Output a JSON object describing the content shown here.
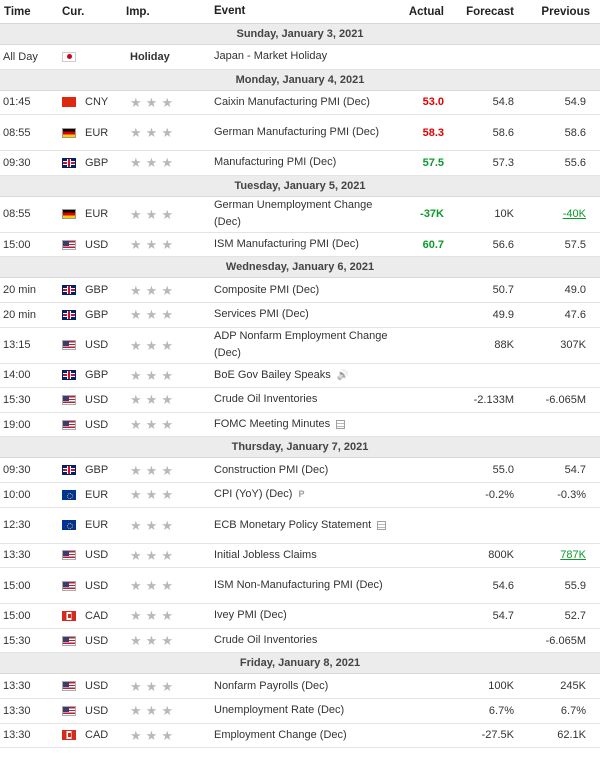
{
  "columns": {
    "time": "Time",
    "currency": "Cur.",
    "importance": "Imp.",
    "event": "Event",
    "actual": "Actual",
    "forecast": "Forecast",
    "previous": "Previous"
  },
  "icons": {
    "star": "star-icon",
    "sound": "speaker-icon",
    "doc": "document-icon",
    "pre": "preliminary-icon"
  },
  "days": [
    {
      "date": "Sunday, January 3, 2021",
      "events": [
        {
          "time": "All Day",
          "flag": "jp",
          "currency": "",
          "holiday": "Holiday",
          "event": "Japan - Market Holiday",
          "actual": "",
          "forecast": "",
          "previous": "",
          "actual_color": "",
          "prev_color": "",
          "tall": false,
          "icon": ""
        }
      ]
    },
    {
      "date": "Monday, January 4, 2021",
      "events": [
        {
          "time": "01:45",
          "flag": "cn",
          "currency": "CNY",
          "event": "Caixin Manufacturing PMI (Dec)",
          "actual": "53.0",
          "forecast": "54.8",
          "previous": "54.9",
          "actual_color": "red",
          "prev_color": "",
          "tall": false,
          "icon": ""
        },
        {
          "time": "08:55",
          "flag": "de",
          "currency": "EUR",
          "event": "German Manufacturing PMI (Dec)",
          "actual": "58.3",
          "forecast": "58.6",
          "previous": "58.6",
          "actual_color": "red",
          "prev_color": "",
          "tall": true,
          "icon": ""
        },
        {
          "time": "09:30",
          "flag": "gb",
          "currency": "GBP",
          "event": "Manufacturing PMI (Dec)",
          "actual": "57.5",
          "forecast": "57.3",
          "previous": "55.6",
          "actual_color": "green",
          "prev_color": "",
          "tall": false,
          "icon": ""
        }
      ]
    },
    {
      "date": "Tuesday, January 5, 2021",
      "events": [
        {
          "time": "08:55",
          "flag": "de",
          "currency": "EUR",
          "event": "German Unemployment Change (Dec)",
          "actual": "-37K",
          "forecast": "10K",
          "previous": "-40K",
          "actual_color": "green",
          "prev_color": "ul-green",
          "tall": true,
          "icon": ""
        },
        {
          "time": "15:00",
          "flag": "us",
          "currency": "USD",
          "event": "ISM Manufacturing PMI (Dec)",
          "actual": "60.7",
          "forecast": "56.6",
          "previous": "57.5",
          "actual_color": "green",
          "prev_color": "",
          "tall": false,
          "icon": ""
        }
      ]
    },
    {
      "date": "Wednesday, January 6, 2021",
      "events": [
        {
          "time": "20 min",
          "flag": "gb",
          "currency": "GBP",
          "event": "Composite PMI (Dec)",
          "actual": "",
          "forecast": "50.7",
          "previous": "49.0",
          "actual_color": "",
          "prev_color": "",
          "tall": false,
          "icon": ""
        },
        {
          "time": "20 min",
          "flag": "gb",
          "currency": "GBP",
          "event": "Services PMI (Dec)",
          "actual": "",
          "forecast": "49.9",
          "previous": "47.6",
          "actual_color": "",
          "prev_color": "",
          "tall": false,
          "icon": ""
        },
        {
          "time": "13:15",
          "flag": "us",
          "currency": "USD",
          "event": "ADP Nonfarm Employment Change (Dec)",
          "actual": "",
          "forecast": "88K",
          "previous": "307K",
          "actual_color": "",
          "prev_color": "",
          "tall": true,
          "icon": ""
        },
        {
          "time": "14:00",
          "flag": "gb",
          "currency": "GBP",
          "event": "BoE Gov Bailey Speaks",
          "actual": "",
          "forecast": "",
          "previous": "",
          "actual_color": "",
          "prev_color": "",
          "tall": false,
          "icon": "sound"
        },
        {
          "time": "15:30",
          "flag": "us",
          "currency": "USD",
          "event": "Crude Oil Inventories",
          "actual": "",
          "forecast": "-2.133M",
          "previous": "-6.065M",
          "actual_color": "",
          "prev_color": "",
          "tall": false,
          "icon": ""
        },
        {
          "time": "19:00",
          "flag": "us",
          "currency": "USD",
          "event": "FOMC Meeting Minutes",
          "actual": "",
          "forecast": "",
          "previous": "",
          "actual_color": "",
          "prev_color": "",
          "tall": false,
          "icon": "doc"
        }
      ]
    },
    {
      "date": "Thursday, January 7, 2021",
      "events": [
        {
          "time": "09:30",
          "flag": "gb",
          "currency": "GBP",
          "event": "Construction PMI (Dec)",
          "actual": "",
          "forecast": "55.0",
          "previous": "54.7",
          "actual_color": "",
          "prev_color": "",
          "tall": false,
          "icon": ""
        },
        {
          "time": "10:00",
          "flag": "eu",
          "currency": "EUR",
          "event": "CPI (YoY) (Dec)",
          "actual": "",
          "forecast": "-0.2%",
          "previous": "-0.3%",
          "actual_color": "",
          "prev_color": "",
          "tall": false,
          "icon": "pre"
        },
        {
          "time": "12:30",
          "flag": "eu",
          "currency": "EUR",
          "event": "ECB Monetary Policy Statement",
          "actual": "",
          "forecast": "",
          "previous": "",
          "actual_color": "",
          "prev_color": "",
          "tall": true,
          "icon": "doc"
        },
        {
          "time": "13:30",
          "flag": "us",
          "currency": "USD",
          "event": "Initial Jobless Claims",
          "actual": "",
          "forecast": "800K",
          "previous": "787K",
          "actual_color": "",
          "prev_color": "ul-green",
          "tall": false,
          "icon": ""
        },
        {
          "time": "15:00",
          "flag": "us",
          "currency": "USD",
          "event": "ISM Non-Manufacturing PMI (Dec)",
          "actual": "",
          "forecast": "54.6",
          "previous": "55.9",
          "actual_color": "",
          "prev_color": "",
          "tall": true,
          "icon": ""
        },
        {
          "time": "15:00",
          "flag": "ca",
          "currency": "CAD",
          "event": "Ivey PMI (Dec)",
          "actual": "",
          "forecast": "54.7",
          "previous": "52.7",
          "actual_color": "",
          "prev_color": "",
          "tall": false,
          "icon": ""
        },
        {
          "time": "15:30",
          "flag": "us",
          "currency": "USD",
          "event": "Crude Oil Inventories",
          "actual": "",
          "forecast": "",
          "previous": "-6.065M",
          "actual_color": "",
          "prev_color": "",
          "tall": false,
          "icon": ""
        }
      ]
    },
    {
      "date": "Friday, January 8, 2021",
      "events": [
        {
          "time": "13:30",
          "flag": "us",
          "currency": "USD",
          "event": "Nonfarm Payrolls (Dec)",
          "actual": "",
          "forecast": "100K",
          "previous": "245K",
          "actual_color": "",
          "prev_color": "",
          "tall": false,
          "icon": ""
        },
        {
          "time": "13:30",
          "flag": "us",
          "currency": "USD",
          "event": "Unemployment Rate (Dec)",
          "actual": "",
          "forecast": "6.7%",
          "previous": "6.7%",
          "actual_color": "",
          "prev_color": "",
          "tall": false,
          "icon": ""
        },
        {
          "time": "13:30",
          "flag": "ca",
          "currency": "CAD",
          "event": "Employment Change (Dec)",
          "actual": "",
          "forecast": "-27.5K",
          "previous": "62.1K",
          "actual_color": "",
          "prev_color": "",
          "tall": false,
          "icon": ""
        }
      ]
    }
  ]
}
